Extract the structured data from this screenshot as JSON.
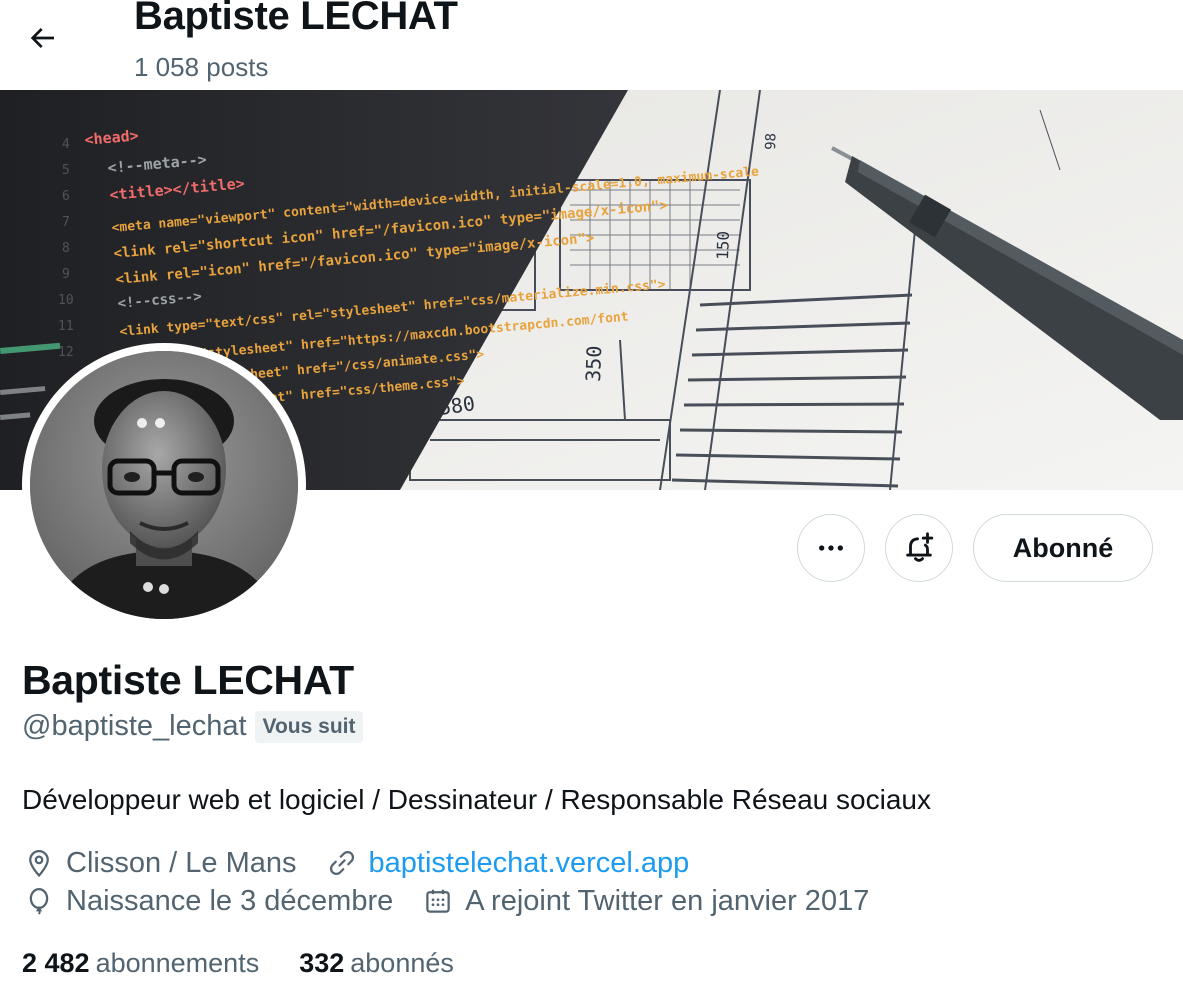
{
  "header": {
    "title": "Baptiste LECHAT",
    "posts_count": "1 058 posts"
  },
  "banner": {
    "code_lines": [
      "<head>",
      "<!--meta-->",
      "<title></title>",
      "<meta name=\"viewport\" content=\"width=device-width, initial-scale=1.0, maximum-scale",
      "<link rel=\"shortcut icon\" href=\"/favicon.ico\" type=\"image/x-icon\">",
      "<link rel=\"icon\" href=\"/favicon.ico\" type=\"image/x-icon\">",
      "<!--css-->",
      "<link type=\"text/css\" rel=\"stylesheet\" href=\"css/materialize.min.css\">",
      "\"stylesheet\" href=\"https://maxcdn.bootstrapcdn.com/font",
      "esheet\" href=\"/css/animate.css\">",
      "et\" href=\"css/theme.css\">"
    ],
    "blueprint_labels": [
      "350",
      "580",
      "150",
      "98"
    ]
  },
  "actions": {
    "follow_label": "Abonné"
  },
  "profile": {
    "name": "Baptiste LECHAT",
    "handle": "@baptiste_lechat",
    "follows_you": "Vous suit",
    "bio": "Développeur web et logiciel / Dessinateur / Responsable Réseau sociaux",
    "location": "Clisson / Le Mans",
    "website": "baptistelechat.vercel.app",
    "birthday": "Naissance le 3 décembre",
    "joined": "A rejoint Twitter en janvier 2017"
  },
  "stats": {
    "following_count": "2 482",
    "following_label": "abonnements",
    "followers_count": "332",
    "followers_label": "abonnés"
  },
  "colors": {
    "accent": "#1d9bf0",
    "secondary_text": "#536471",
    "border": "#cfd9de"
  }
}
